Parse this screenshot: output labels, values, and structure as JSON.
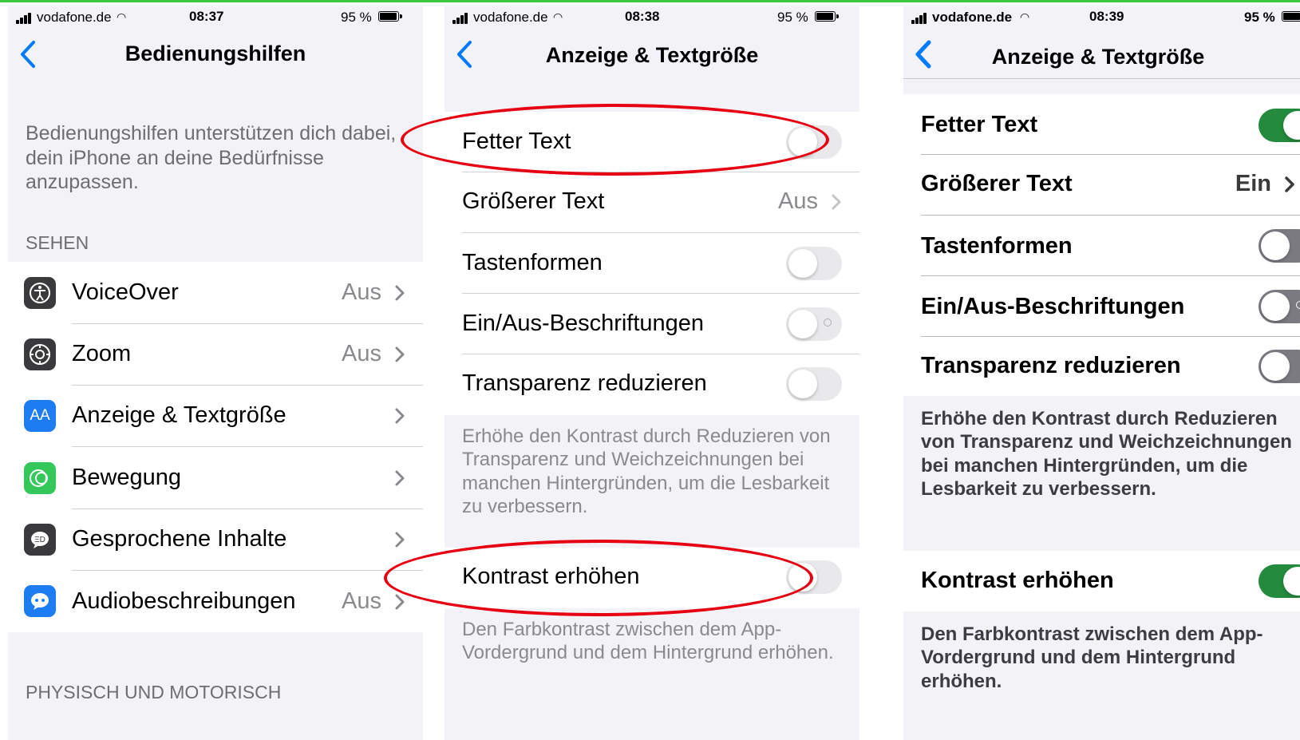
{
  "status_bars": [
    {
      "carrier": "vodafone.de",
      "time": "08:37",
      "battery": "95 %"
    },
    {
      "carrier": "vodafone.de",
      "time": "08:38",
      "battery": "95 %"
    },
    {
      "carrier": "vodafone.de",
      "time": "08:39",
      "battery": "95 %"
    }
  ],
  "screen1": {
    "title": "Bedienungshilfen",
    "intro": "Bedienungshilfen unterstützen dich dabei, dein iPhone an deine Bedürfnisse anzupassen.",
    "section_sehen": "SEHEN",
    "items": [
      {
        "label": "VoiceOver",
        "value": "Aus",
        "icon": "voiceover-icon",
        "color": "#3a3a3c"
      },
      {
        "label": "Zoom",
        "value": "Aus",
        "icon": "zoom-icon",
        "color": "#3a3a3c"
      },
      {
        "label": "Anzeige & Textgröße",
        "value": "",
        "icon": "text-size-icon",
        "icon_text": "AA",
        "color": "#1e7cf2"
      },
      {
        "label": "Bewegung",
        "value": "",
        "icon": "motion-icon",
        "color": "#34c759"
      },
      {
        "label": "Gesprochene Inhalte",
        "value": "",
        "icon": "spoken-content-icon",
        "color": "#3a3a3c"
      },
      {
        "label": "Audiobeschreibungen",
        "value": "Aus",
        "icon": "audio-description-icon",
        "color": "#1e7cf2"
      }
    ],
    "section_physisch": "PHYSISCH UND MOTORISCH"
  },
  "screen2": {
    "title": "Anzeige & Textgröße",
    "rows": [
      {
        "label": "Fetter Text",
        "type": "toggle",
        "on": false
      },
      {
        "label": "Größerer Text",
        "type": "value",
        "value": "Aus"
      },
      {
        "label": "Tastenformen",
        "type": "toggle",
        "on": false
      },
      {
        "label": "Ein/Aus-Beschriftungen",
        "type": "toggle",
        "on": false
      },
      {
        "label": "Transparenz reduzieren",
        "type": "toggle",
        "on": false
      }
    ],
    "transparency_footer": "Erhöhe den Kontrast durch Reduzieren von Transparenz und Weichzeichnungen bei manchen Hintergründen, um die Lesbarkeit zu verbessern.",
    "contrast_label": "Kontrast erhöhen",
    "contrast_on": false,
    "contrast_footer": "Den Farbkontrast zwischen dem App-Vordergrund und dem Hintergrund erhöhen."
  },
  "screen3": {
    "title": "Anzeige & Textgröße",
    "rows": [
      {
        "label": "Fetter Text",
        "type": "toggle",
        "on": true
      },
      {
        "label": "Größerer Text",
        "type": "value",
        "value": "Ein"
      },
      {
        "label": "Tastenformen",
        "type": "toggle",
        "on": false
      },
      {
        "label": "Ein/Aus-Beschriftungen",
        "type": "toggle",
        "on": false
      },
      {
        "label": "Transparenz reduzieren",
        "type": "toggle",
        "on": false
      }
    ],
    "transparency_footer": "Erhöhe den Kontrast durch Reduzieren von Transparenz und Weichzeichnungen bei manchen Hintergründen, um die Lesbarkeit zu verbessern.",
    "contrast_label": "Kontrast erhöhen",
    "contrast_on": true,
    "contrast_footer": "Den Farbkontrast zwischen dem App-Vordergrund und dem Hintergrund erhöhen."
  },
  "colors": {
    "ios_blue": "#007aff",
    "toggle_on": "#34c759",
    "highlight_red": "#e60012",
    "border_green": "#3cc83c"
  }
}
